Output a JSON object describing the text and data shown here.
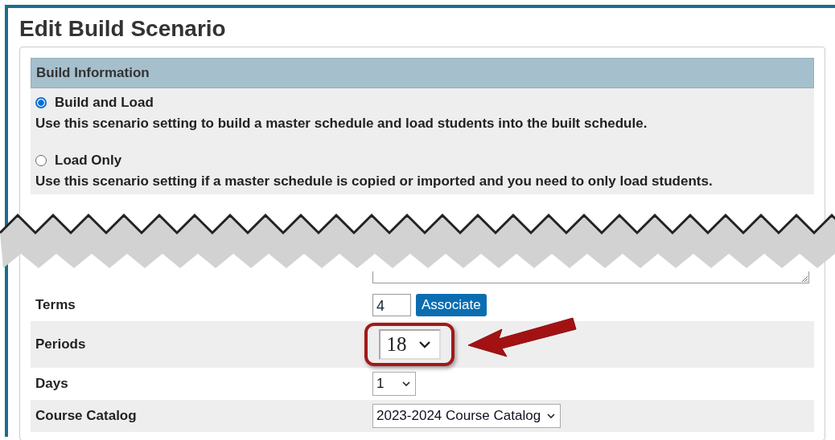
{
  "page": {
    "title": "Edit Build Scenario"
  },
  "section": {
    "header": "Build Information"
  },
  "build_options": [
    {
      "label": "Build and Load",
      "selected": true,
      "description": "Use this scenario setting to build a master schedule and load students into the built schedule."
    },
    {
      "label": "Load Only",
      "selected": false,
      "description": "Use this scenario setting if a master schedule is copied or imported and you need to only load students."
    }
  ],
  "fields": [
    {
      "kind": "text_button",
      "label": "Terms",
      "value": "4",
      "button": "Associate"
    },
    {
      "kind": "callout_select",
      "label": "Periods",
      "value": "18"
    },
    {
      "kind": "select",
      "label": "Days",
      "value": "1"
    },
    {
      "kind": "select",
      "label": "Course Catalog",
      "value": "2023-2024 Course Catalog"
    }
  ]
}
